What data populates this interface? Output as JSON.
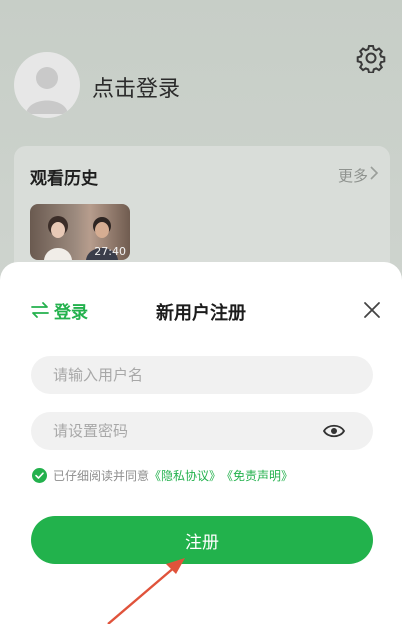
{
  "profile": {
    "login_prompt": "点击登录"
  },
  "history": {
    "title": "观看历史",
    "more_label": "更多",
    "items": [
      {
        "duration": "27:40"
      }
    ]
  },
  "sheet": {
    "switch_login_label": "登录",
    "title": "新用户注册",
    "username_placeholder": "请输入用户名",
    "username_value": "",
    "password_placeholder": "请设置密码",
    "password_value": "",
    "agreement": {
      "prefix": "已仔细阅读并同意",
      "privacy_link": "《隐私协议》",
      "disclaimer_link": "《免责声明》"
    },
    "register_label": "注册"
  },
  "colors": {
    "accent": "#22b24c",
    "field_bg": "#f1f1f1",
    "overlay_bg": "#cfd3cf",
    "arrow": "#e0533b"
  },
  "icons": {
    "settings": "gear-icon",
    "avatar": "default-avatar",
    "more": "chevron-right-icon",
    "switch": "swap-arrows-icon",
    "close": "close-icon",
    "password_toggle": "eye-icon",
    "agree_check": "check-circle-icon"
  }
}
